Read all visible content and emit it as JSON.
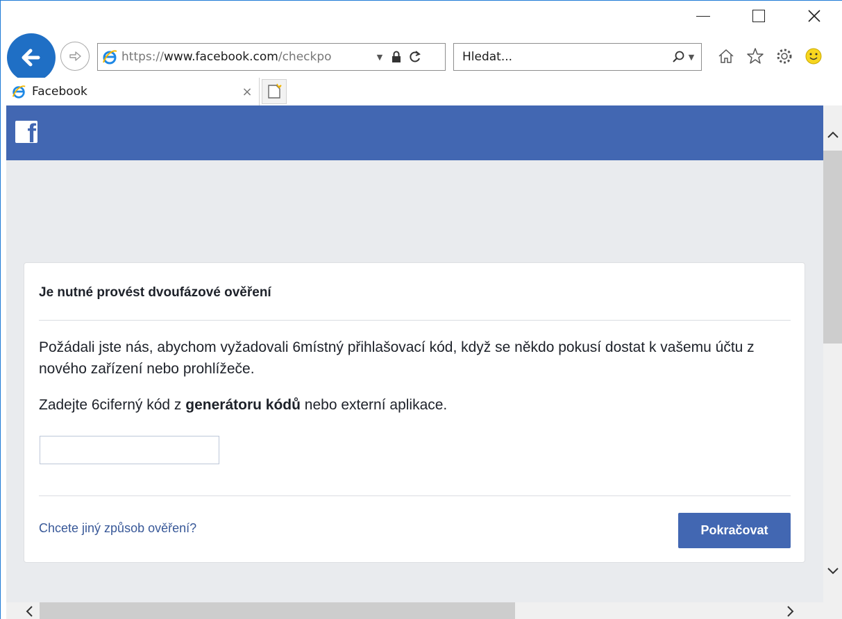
{
  "browser": {
    "address": {
      "host_prefix": "https://",
      "host": "www.facebook.com",
      "path": "/checkpo"
    },
    "search": {
      "placeholder": "Hledat..."
    },
    "tab": {
      "title": "Facebook"
    },
    "icons": {
      "back": "arrow-left-icon",
      "forward": "arrow-right-icon",
      "ie": "internet-explorer-icon",
      "lock": "lock-icon",
      "refresh": "refresh-icon",
      "search": "search-icon",
      "home": "home-icon",
      "favorites": "star-icon",
      "settings": "gear-icon",
      "feedback": "smiley-icon"
    }
  },
  "page": {
    "logo": "f",
    "card": {
      "title": "Je nutné provést dvoufázové ověření",
      "description": "Požádali jste nás, abychom vyžadovali 6místný přihlašovací kód, když se někdo pokusí dostat k vašemu účtu z nového zařízení nebo prohlížeče.",
      "instruction_before": "Zadejte 6ciferný kód z ",
      "instruction_bold": "generátoru kódů",
      "instruction_after": " nebo externí aplikace.",
      "code_value": "",
      "alt_link": "Chcete jiný způsob ověření?",
      "continue_label": "Pokračovat"
    }
  },
  "colors": {
    "facebook_blue": "#4267b2",
    "link": "#385898",
    "background": "#e9ebee",
    "ie_back": "#1f6fc5"
  }
}
